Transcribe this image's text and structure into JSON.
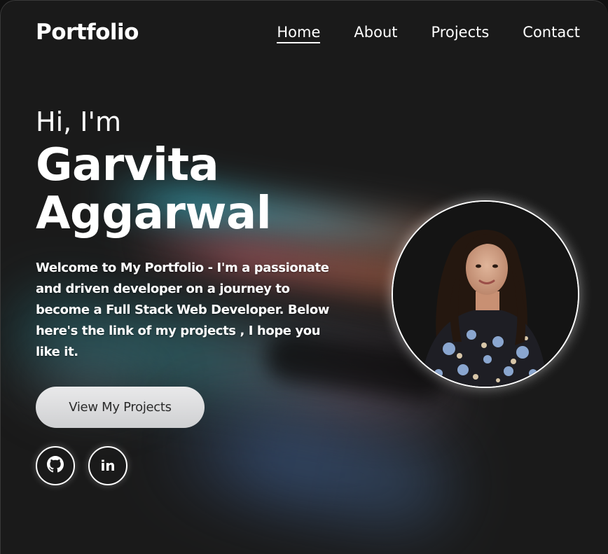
{
  "nav": {
    "logo": "Portfolio",
    "links": [
      "Home",
      "About",
      "Projects",
      "Contact"
    ],
    "active": "Home"
  },
  "hero": {
    "greeting": "Hi, I'm",
    "first_name": "Garvita",
    "last_name": "Aggarwal",
    "intro": "Welcome to My Portfolio - I'm a passionate and driven developer on a journey to become a Full Stack Web Developer. Below here's the link of my projects , I hope you like it.",
    "cta_label": "View My Projects"
  },
  "social": {
    "linkedin_label": "in",
    "icons": [
      "github-icon",
      "linkedin-icon"
    ]
  },
  "colors": {
    "background": "#1a1a1a",
    "text": "#ffffff",
    "button_bg": "#dcdcde",
    "button_text": "#2b2b2b"
  }
}
